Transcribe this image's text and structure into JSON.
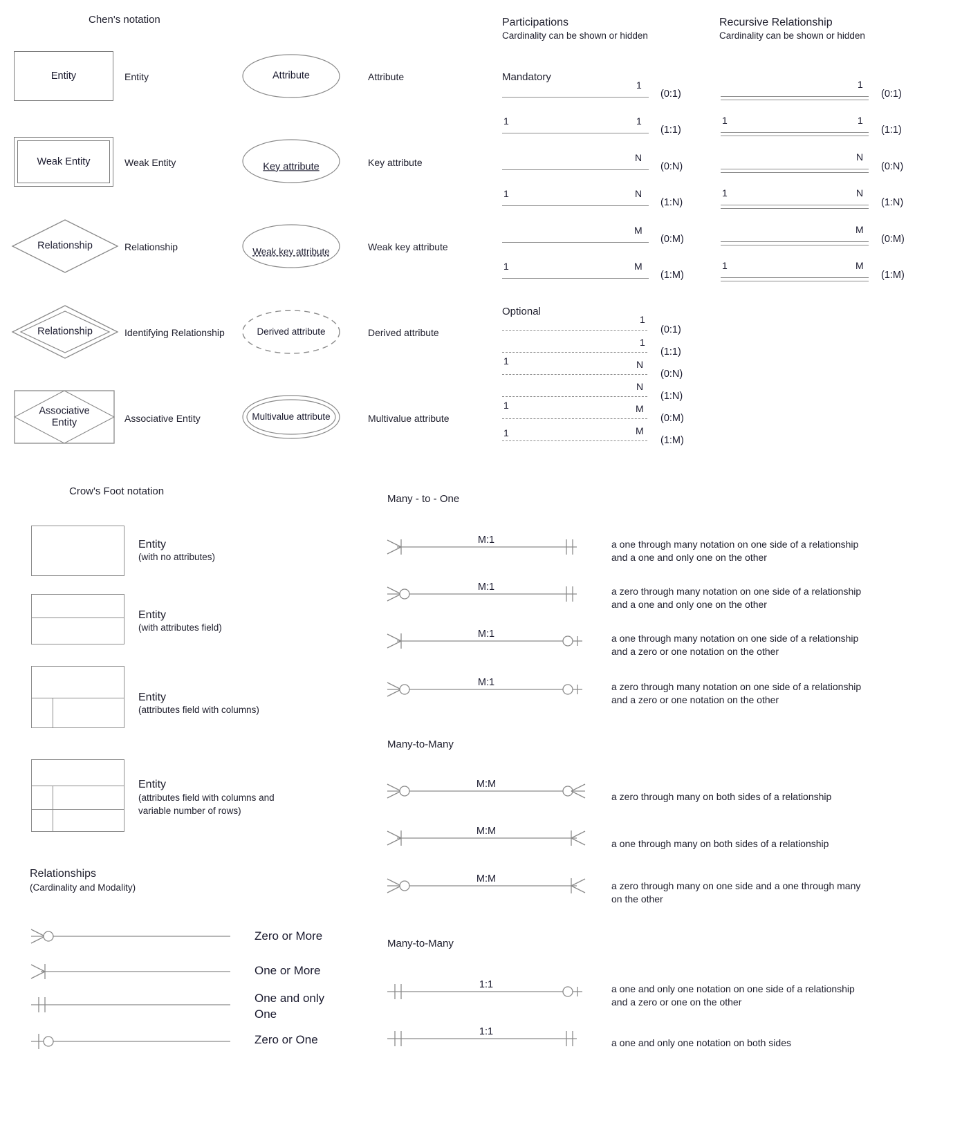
{
  "chen": {
    "title": "Chen's notation",
    "shapes": [
      {
        "shape_label": "Entity",
        "caption": "Entity"
      },
      {
        "shape_label": "Weak Entity",
        "caption": "Weak Entity"
      },
      {
        "shape_label": "Relationship",
        "caption": "Relationship"
      },
      {
        "shape_label": "Relationship",
        "caption": "Identifying Relationship"
      },
      {
        "shape_label": "Associative\nEntity",
        "caption": "Associative Entity"
      }
    ],
    "attributes": [
      {
        "shape_label": "Attribute",
        "caption": "Attribute"
      },
      {
        "shape_label": "Key attribute",
        "caption": "Key attribute"
      },
      {
        "shape_label": "Weak key attribute",
        "caption": "Weak key attribute"
      },
      {
        "shape_label": "Derived attribute",
        "caption": "Derived attribute"
      },
      {
        "shape_label": "Multivalue attribute",
        "caption": "Multivalue attribute"
      }
    ]
  },
  "participations": {
    "title": "Participations",
    "subtitle": "Cardinality can be shown or hidden",
    "mandatory_label": "Mandatory",
    "optional_label": "Optional",
    "mandatory_rows": [
      {
        "left": "",
        "right": "1",
        "card": "(0:1)"
      },
      {
        "left": "1",
        "right": "1",
        "card": "(1:1)"
      },
      {
        "left": "",
        "right": "N",
        "card": "(0:N)"
      },
      {
        "left": "1",
        "right": "N",
        "card": "(1:N)"
      },
      {
        "left": "",
        "right": "M",
        "card": "(0:M)"
      },
      {
        "left": "1",
        "right": "M",
        "card": "(1:M)"
      }
    ],
    "optional_rows": [
      {
        "left": "",
        "right": "1",
        "card": "(0:1)"
      },
      {
        "left": "",
        "right": "1",
        "card": "(1:1)"
      },
      {
        "left": "1",
        "right": "N",
        "card": "(0:N)"
      },
      {
        "left": "",
        "right": "N",
        "card": "(1:N)"
      },
      {
        "left": "1",
        "right": "M",
        "card": "(0:M)"
      },
      {
        "left": "1",
        "right": "M",
        "card": "(1:M)"
      }
    ]
  },
  "recursive": {
    "title": "Recursive Relationship",
    "subtitle": "Cardinality can be shown or hidden",
    "rows": [
      {
        "left": "",
        "right": "1",
        "card": "(0:1)"
      },
      {
        "left": "1",
        "right": "1",
        "card": "(1:1)"
      },
      {
        "left": "",
        "right": "N",
        "card": "(0:N)"
      },
      {
        "left": "1",
        "right": "N",
        "card": "(1:N)"
      },
      {
        "left": "",
        "right": "M",
        "card": "(0:M)"
      },
      {
        "left": "1",
        "right": "M",
        "card": "(1:M)"
      }
    ]
  },
  "crowsfoot": {
    "title": "Crow's Foot notation",
    "entities": [
      {
        "name": "Entity",
        "detail": "(with no attributes)"
      },
      {
        "name": "Entity",
        "detail": "(with attributes field)"
      },
      {
        "name": "Entity",
        "detail": "(attributes field with columns)"
      },
      {
        "name": "Entity",
        "detail": "(attributes field with columns and\nvariable number of rows)"
      }
    ],
    "relationships_title": "Relationships",
    "relationships_subtitle": "(Cardinality and Modality)",
    "modality": [
      {
        "label": "Zero or More",
        "symbol": "crowfoot-circle"
      },
      {
        "label": "One or More",
        "symbol": "crowfoot-bar"
      },
      {
        "label": "One and only\nOne",
        "symbol": "double-bar"
      },
      {
        "label": "Zero or One",
        "symbol": "bar-circle"
      }
    ]
  },
  "many_to_one": {
    "title": "Many - to - One",
    "rows": [
      {
        "cardinality": "M:1",
        "left_symbol": "crowfoot-bar",
        "right_symbol": "double-bar",
        "description": "a one through many notation on one side of a relationship\nand a one and only one on the other"
      },
      {
        "cardinality": "M:1",
        "left_symbol": "crowfoot-circle",
        "right_symbol": "double-bar",
        "description": "a zero through many notation on one side of a relationship\nand a one and only one on the other"
      },
      {
        "cardinality": "M:1",
        "left_symbol": "crowfoot-bar",
        "right_symbol": "circle-bar",
        "description": "a one through many notation on one side of a relationship\nand a zero or one notation on the other"
      },
      {
        "cardinality": "M:1",
        "left_symbol": "crowfoot-circle",
        "right_symbol": "circle-bar",
        "description": "a zero through many notation on one side of a relationship\nand a zero or one notation on the other"
      }
    ]
  },
  "many_to_many": {
    "title": "Many-to-Many",
    "rows": [
      {
        "cardinality": "M:M",
        "left_symbol": "crowfoot-circle",
        "right_symbol": "circle-crowfoot",
        "description": "a zero through many on both sides of a relationship"
      },
      {
        "cardinality": "M:M",
        "left_symbol": "crowfoot-bar",
        "right_symbol": "crowfoot-right",
        "description": "a one through many on both sides of a relationship"
      },
      {
        "cardinality": "M:M",
        "left_symbol": "crowfoot-circle",
        "right_symbol": "crowfoot-right",
        "description": "a zero through many on one side and a one through many\non the other"
      }
    ]
  },
  "one_to_one": {
    "title": "Many-to-Many",
    "rows": [
      {
        "cardinality": "1:1",
        "left_symbol": "double-bar",
        "right_symbol": "circle-bar",
        "description": "a one and only one notation on one side of a relationship\nand a zero or one on the other"
      },
      {
        "cardinality": "1:1",
        "left_symbol": "double-bar",
        "right_symbol": "double-bar",
        "description": "a one and only one notation on both sides"
      }
    ]
  }
}
